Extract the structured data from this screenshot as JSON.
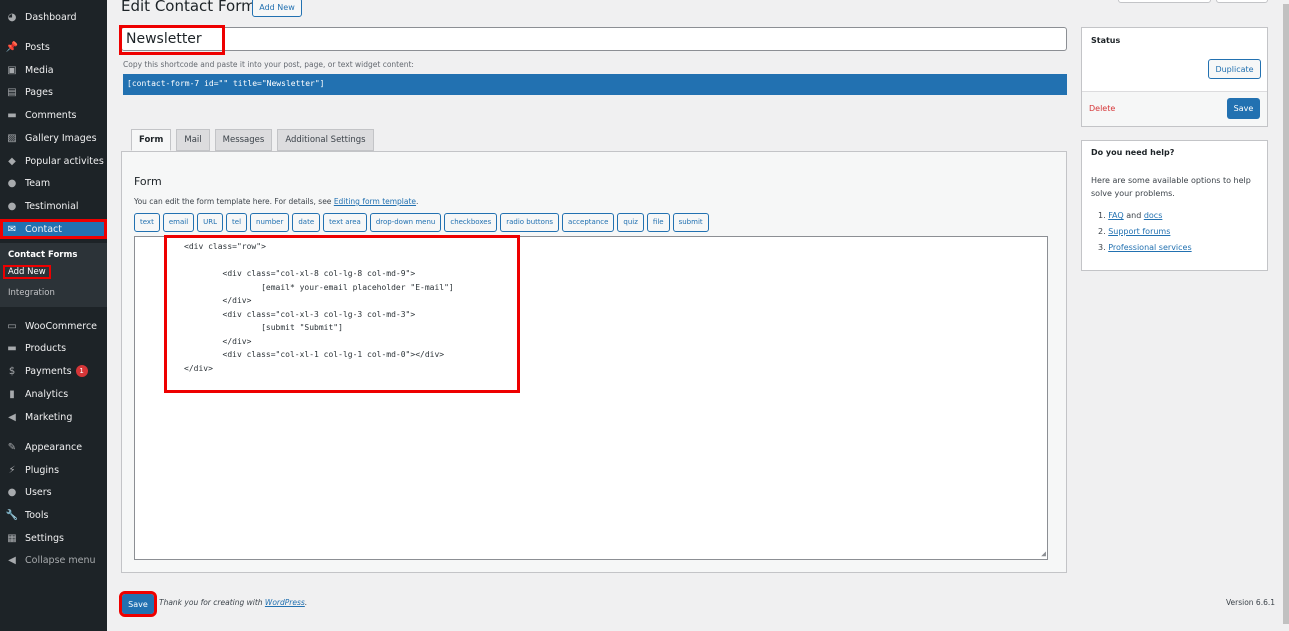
{
  "sidebar": {
    "items": [
      {
        "label": "Dashboard",
        "icon": "dashboard-icon"
      },
      {
        "label": "Posts",
        "icon": "pin-icon"
      },
      {
        "label": "Media",
        "icon": "media-icon"
      },
      {
        "label": "Pages",
        "icon": "pages-icon"
      },
      {
        "label": "Comments",
        "icon": "comment-icon"
      },
      {
        "label": "Gallery Images",
        "icon": "gallery-icon"
      },
      {
        "label": "Popular activites",
        "icon": "mortarboard-icon"
      },
      {
        "label": "Team",
        "icon": "user-icon"
      },
      {
        "label": "Testimonial",
        "icon": "user-tie-icon"
      },
      {
        "label": "Contact",
        "icon": "envelope-icon"
      },
      {
        "label": "WooCommerce",
        "icon": "woo-icon"
      },
      {
        "label": "Products",
        "icon": "archive-icon"
      },
      {
        "label": "Payments",
        "icon": "dollar-icon",
        "badge": "1"
      },
      {
        "label": "Analytics",
        "icon": "bar-chart-icon"
      },
      {
        "label": "Marketing",
        "icon": "megaphone-icon"
      },
      {
        "label": "Appearance",
        "icon": "brush-icon"
      },
      {
        "label": "Plugins",
        "icon": "plug-icon"
      },
      {
        "label": "Users",
        "icon": "user-icon"
      },
      {
        "label": "Tools",
        "icon": "wrench-icon"
      },
      {
        "label": "Settings",
        "icon": "settings-icon"
      },
      {
        "label": "Collapse menu",
        "icon": "collapse-icon"
      }
    ],
    "submenu": [
      "Contact Forms",
      "Add New",
      "Integration"
    ]
  },
  "header": {
    "title": "Edit Contact Form",
    "add_new": "Add New"
  },
  "form_title": "Newsletter",
  "shortcode_hint": "Copy this shortcode and paste it into your post, page, or text widget content:",
  "shortcode": "[contact-form-7 id=\"\" title=\"Newsletter\"]",
  "tabs": [
    "Form",
    "Mail",
    "Messages",
    "Additional Settings"
  ],
  "panel": {
    "heading": "Form",
    "desc": "You can edit the form template here. For details, see ",
    "desc_link": "Editing form template",
    "desc_end": ".",
    "tags": [
      "text",
      "email",
      "URL",
      "tel",
      "number",
      "date",
      "text area",
      "drop-down menu",
      "checkboxes",
      "radio buttons",
      "acceptance",
      "quiz",
      "file",
      "submit"
    ],
    "code": "<div class=\"row\">\n\n        <div class=\"col-xl-8 col-lg-8 col-md-9\">\n                [email* your-email placeholder \"E-mail\"]\n        </div>\n        <div class=\"col-xl-3 col-lg-3 col-md-3\">\n                [submit \"Submit\"]\n        </div>\n        <div class=\"col-xl-1 col-lg-1 col-md-0\"></div>\n</div>"
  },
  "status": {
    "title": "Status",
    "duplicate": "Duplicate",
    "delete": "Delete",
    "save": "Save"
  },
  "help": {
    "title": "Do you need help?",
    "text": "Here are some available options to help solve your problems.",
    "faq": "FAQ",
    "and": " and ",
    "docs": "docs",
    "support": "Support forums",
    "pro": "Professional services"
  },
  "footer": {
    "save": "Save",
    "thanks": "Thank you for creating with ",
    "wp": "WordPress",
    "dot": ".",
    "version": "Version 6.6.1"
  }
}
